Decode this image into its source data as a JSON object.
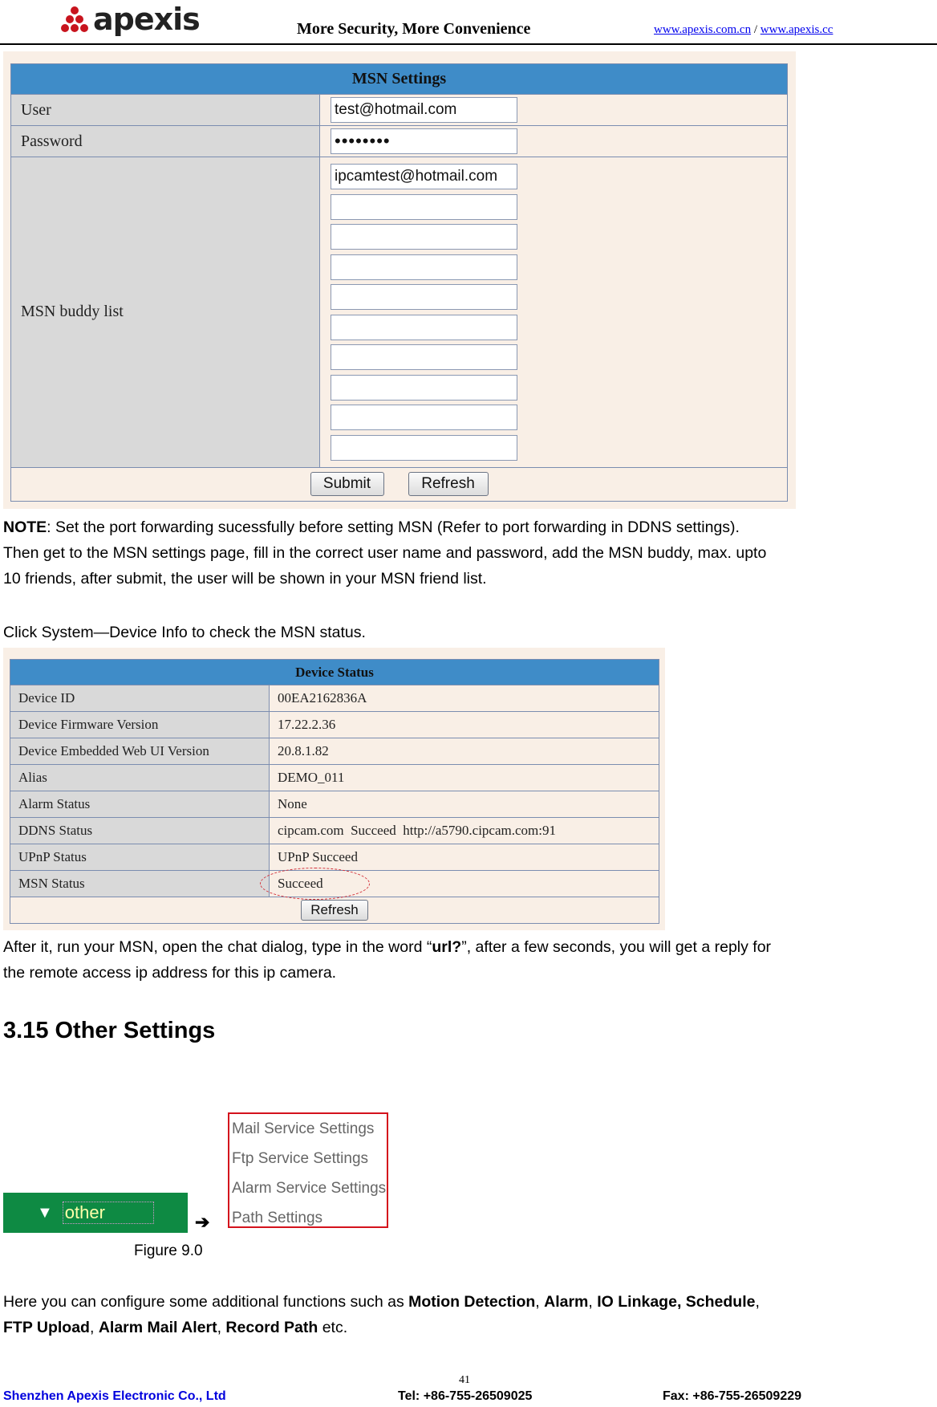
{
  "header": {
    "logo_text": "apexis",
    "tagline": "More Security, More Convenience",
    "link1": "www.apexis.com.cn",
    "separator": " / ",
    "link2": "www.apexis.cc"
  },
  "msn_settings": {
    "title": "MSN Settings",
    "user_label": "User",
    "user_value": "test@hotmail.com",
    "password_label": "Password",
    "password_value": "••••••••",
    "buddy_label": "MSN buddy list",
    "buddies": [
      "ipcamtest@hotmail.com",
      "",
      "",
      "",
      "",
      "",
      "",
      "",
      "",
      ""
    ],
    "submit_label": "Submit",
    "refresh_label": "Refresh"
  },
  "note": {
    "note_bold": "NOTE",
    "line1": ": Set the port forwarding sucessfully before setting MSN (Refer to port forwarding in DDNS settings).",
    "line2": "Then get to the MSN settings page, fill in the correct user name and password, add the MSN buddy, max. upto",
    "line3": "10 friends, after submit, the user will be shown in your MSN friend list."
  },
  "click_instruction": "Click System—Device Info to check the MSN status.",
  "device_status": {
    "title": "Device Status",
    "rows": [
      {
        "label": "Device ID",
        "value": "00EA2162836A"
      },
      {
        "label": "Device Firmware Version",
        "value": "17.22.2.36"
      },
      {
        "label": "Device Embedded Web UI Version",
        "value": "20.8.1.82"
      },
      {
        "label": "Alias",
        "value": "DEMO_011"
      },
      {
        "label": "Alarm Status",
        "value": "None"
      },
      {
        "label": "DDNS Status",
        "value": "cipcam.com  Succeed  http://a5790.cipcam.com:91"
      },
      {
        "label": "UPnP Status",
        "value": "UPnP Succeed"
      },
      {
        "label": "MSN Status",
        "value": "Succeed"
      }
    ],
    "refresh_label": "Refresh"
  },
  "after_text": {
    "part1": "After it, run your MSN, open the chat dialog, type in the word “",
    "bold": "url?",
    "part2": "”, after a few seconds, you will get a reply for",
    "line2": "the remote access ip address for this ip camera."
  },
  "section_title": "3.15 Other Settings",
  "figure": {
    "menu_label": "other",
    "arrow": "➔",
    "submenu": [
      "Mail Service Settings",
      "Ftp Service Settings",
      "Alarm Service Settings",
      "Path Settings"
    ],
    "caption": "Figure 9.0"
  },
  "description": {
    "intro": "Here you can configure some additional functions such as ",
    "b1": "Motion Detection",
    "s1": ", ",
    "b2": "Alarm",
    "s2": ", ",
    "b3": "IO Linkage, Schedule",
    "s3": ",",
    "b4": "FTP Upload",
    "s4": ", ",
    "b5": "Alarm Mail Alert",
    "s5": ", ",
    "b6": "Record Path",
    "s6": " etc."
  },
  "footer": {
    "page_number": "41",
    "company": "Shenzhen Apexis Electronic Co., Ltd",
    "tel": "Tel: +86-755-26509025",
    "fax": "Fax: +86-755-26509229"
  },
  "colors": {
    "table_header": "#3f8cc8",
    "panel_bg": "#f9efe6",
    "label_bg": "#d9d9d9",
    "menu_green": "#0e8a43",
    "highlight_red": "#d4121c",
    "footer_blue": "#0000dd"
  }
}
